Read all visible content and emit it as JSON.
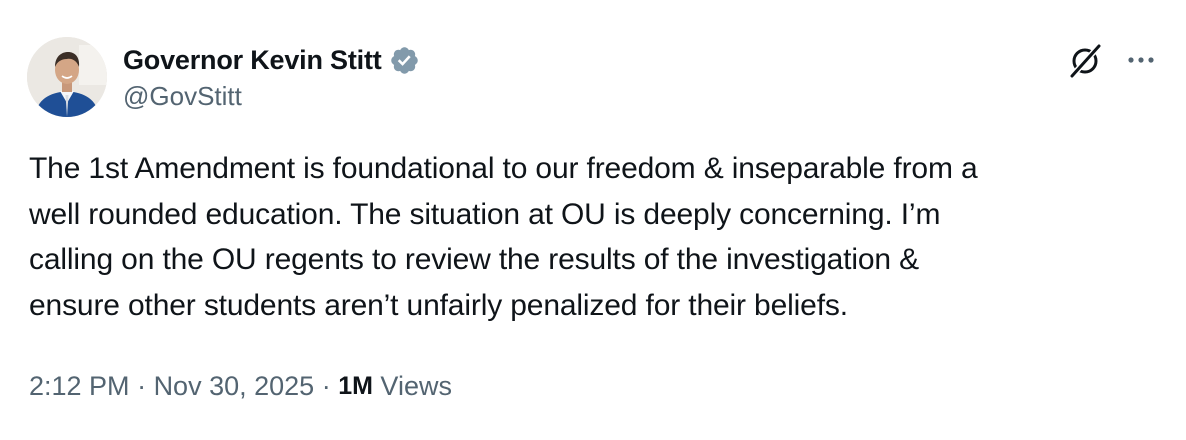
{
  "author": {
    "display_name": "Governor Kevin Stitt",
    "handle": "@GovStitt",
    "verified": true
  },
  "tweet": {
    "text": "The 1st Amendment is foundational to our freedom & inseparable from a\nwell rounded education. The situation at OU is deeply concerning. I’m\ncalling on the OU regents to review the results of the investigation &\nensure other students aren’t unfairly penalized for their beliefs.",
    "time": "2:12 PM",
    "separator": " · ",
    "date": "Nov 30, 2025",
    "views_count": "1M",
    "views_label": " Views"
  },
  "icons": {
    "verified": "verified-badge-icon",
    "grok": "grok-icon",
    "more": "more-options-icon"
  },
  "colors": {
    "text_primary": "#0f1419",
    "text_secondary": "#536471",
    "verified_badge": "#829aab"
  }
}
